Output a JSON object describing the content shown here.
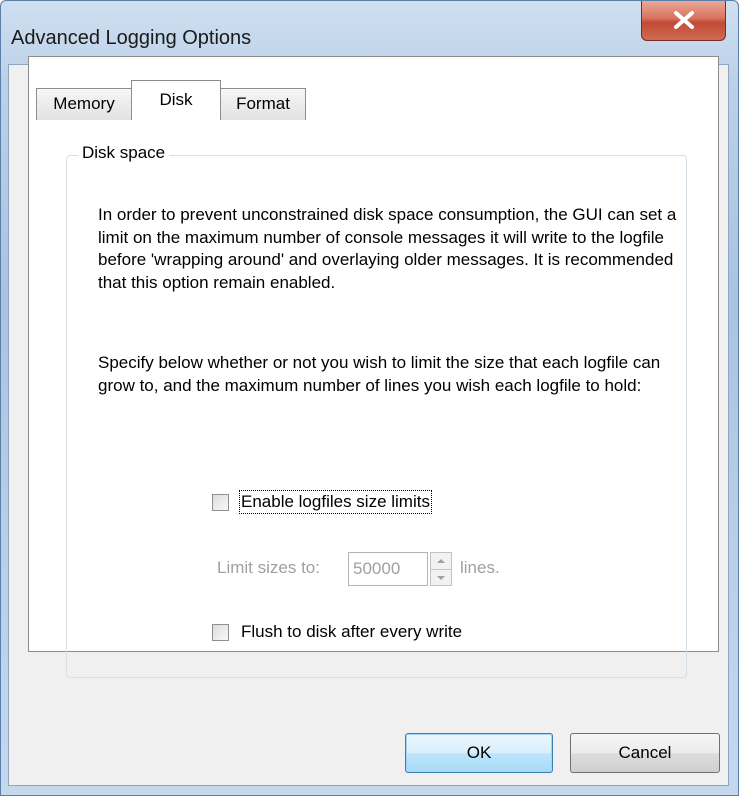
{
  "window": {
    "title": "Advanced Logging Options"
  },
  "tabs": [
    {
      "label": "Memory",
      "active": false
    },
    {
      "label": "Disk",
      "active": true
    },
    {
      "label": "Format",
      "active": false
    }
  ],
  "disk": {
    "group_label": "Disk space",
    "para1": "In order to prevent unconstrained disk space consumption, the GUI can set a limit on the maximum number of console messages it will write to the logfile before 'wrapping around' and overlaying older messages. It is recommended that this option remain enabled.",
    "para2": "Specify below whether or not you wish to limit the size that each logfile can grow to, and the maximum number of lines you wish each logfile to hold:",
    "enable_limits": {
      "label": "Enable logfiles size limits",
      "checked": false
    },
    "limit": {
      "prefix": "Limit sizes to:",
      "value": "50000",
      "suffix": "lines.",
      "enabled": false
    },
    "flush": {
      "label": "Flush to disk after every write",
      "checked": false
    }
  },
  "buttons": {
    "ok": "OK",
    "cancel": "Cancel"
  },
  "icons": {
    "close": "close-icon",
    "spin_up": "spin-up-icon",
    "spin_down": "spin-down-icon"
  },
  "colors": {
    "close_button": "#c8503a",
    "default_button_border": "#3c7fb1"
  }
}
